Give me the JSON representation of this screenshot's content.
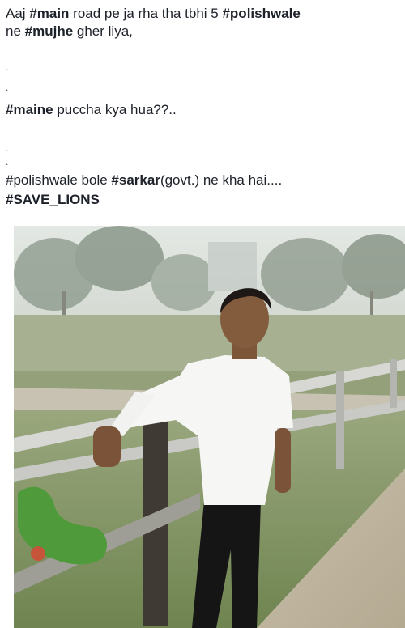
{
  "post": {
    "line1": {
      "t1": "Aaj ",
      "h1": "#main",
      "t2": " road pe ja rha tha tbhi 5 ",
      "h2": "#polishwale"
    },
    "line2": {
      "t1": "ne ",
      "h1": "#mujhe",
      "t2": " gher liya,"
    },
    "dot1": ".",
    "dot2": ".",
    "line3": {
      "h1": "#maine",
      "t1": " puccha kya hua??.."
    },
    "dot3": ".",
    "dot4": ".",
    "line4": {
      "t1": "#polishwale bole ",
      "h1": "#sarkar",
      "t2": "(govt.) ne kha hai...."
    },
    "line5": {
      "h1": "#SAVE_LIONS"
    }
  },
  "photo": {
    "sky_color": "#dfe4e0",
    "grass_color": "#8fa06d",
    "shirt_color": "#f7f7f5",
    "pants_color": "#141414",
    "badge_color": "#4f9a3a"
  }
}
